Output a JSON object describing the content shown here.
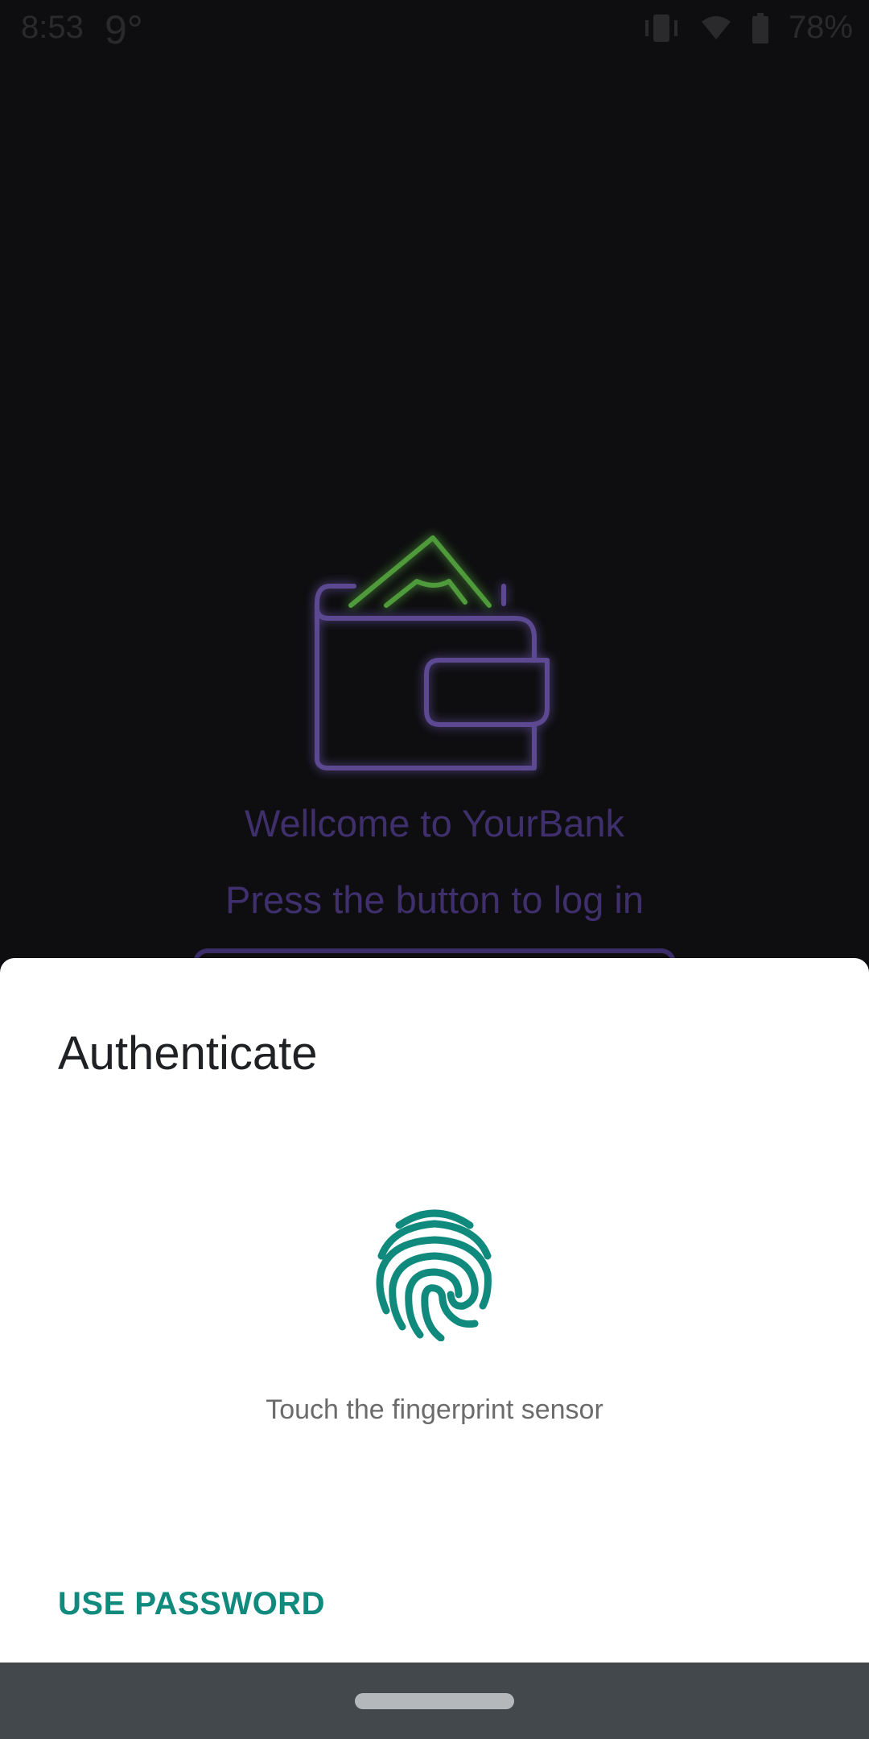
{
  "status_bar": {
    "time": "8:53",
    "temperature": "9°",
    "battery_percent": "78%",
    "icons": [
      "vibrate-icon",
      "wifi-icon",
      "battery-icon"
    ]
  },
  "background_app": {
    "logo_icon": "wallet-icon",
    "welcome_text": "Wellcome to YourBank",
    "instruction_text": "Press the button to log in"
  },
  "auth_sheet": {
    "title": "Authenticate",
    "sensor_icon": "fingerprint-icon",
    "hint": "Touch the fingerprint sensor",
    "use_password_label": "USE PASSWORD"
  },
  "colors": {
    "accent": "#0f8a7d",
    "background": "#0e0e10",
    "wallet_stroke": "#6a55a8",
    "money_stroke": "#4f9a3a",
    "nav_bar": "#43484d"
  }
}
